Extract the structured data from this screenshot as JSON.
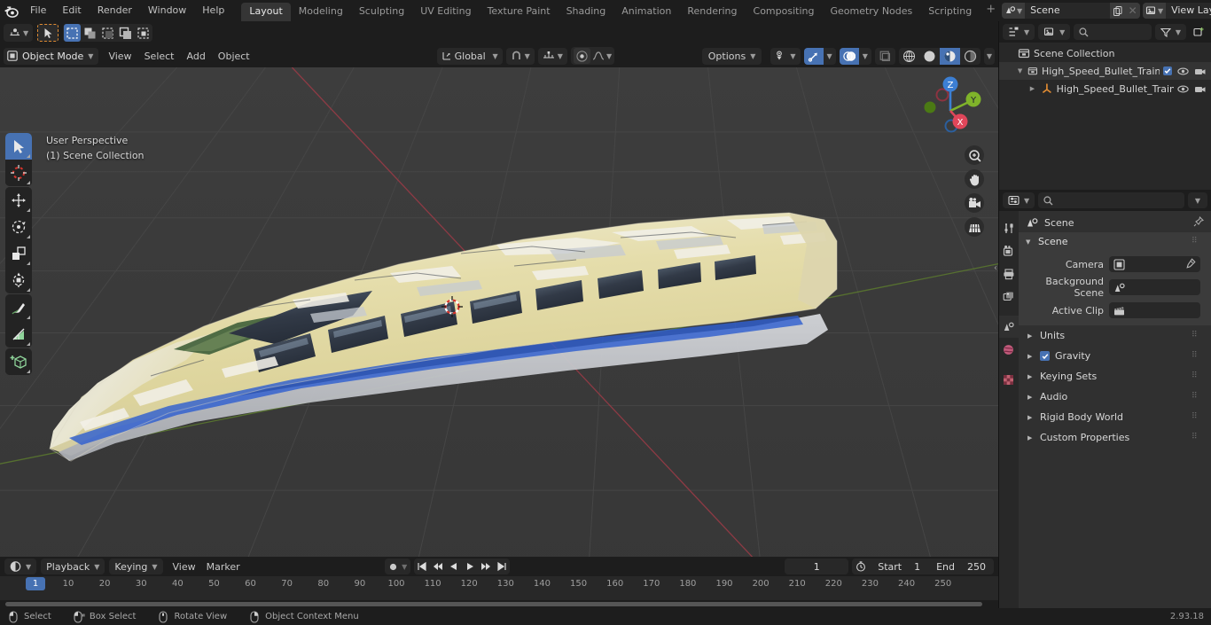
{
  "app": {
    "version": "2.93.18",
    "logo_icon": "blender-logo"
  },
  "topbar": {
    "menus": [
      "File",
      "Edit",
      "Render",
      "Window",
      "Help"
    ],
    "workspaces": [
      {
        "label": "Layout",
        "active": true
      },
      {
        "label": "Modeling",
        "active": false
      },
      {
        "label": "Sculpting",
        "active": false
      },
      {
        "label": "UV Editing",
        "active": false
      },
      {
        "label": "Texture Paint",
        "active": false
      },
      {
        "label": "Shading",
        "active": false
      },
      {
        "label": "Animation",
        "active": false
      },
      {
        "label": "Rendering",
        "active": false
      },
      {
        "label": "Compositing",
        "active": false
      },
      {
        "label": "Geometry Nodes",
        "active": false
      },
      {
        "label": "Scripting",
        "active": false
      }
    ],
    "add_workspace_label": "+",
    "scene": {
      "name": "Scene",
      "icon": "scene-icon",
      "copy_icon": "duplicate-icon",
      "close_icon": "x-icon"
    },
    "view_layer": {
      "name": "View Layer",
      "icon": "view-layer-icon",
      "copy_icon": "duplicate-icon",
      "close_icon": "x-icon"
    }
  },
  "toolheader": {
    "editor_type_icon": "editor-type-icon",
    "active_tool_icon": "tweak-cursor-icon",
    "select_modes": [
      {
        "icon": "select-new-icon",
        "active": true
      },
      {
        "icon": "select-extend-icon",
        "active": false
      },
      {
        "icon": "select-subtract-icon",
        "active": false
      },
      {
        "icon": "select-invert-icon",
        "active": false
      },
      {
        "icon": "select-intersect-icon",
        "active": false
      }
    ]
  },
  "viewport_header": {
    "mode": "Object Mode",
    "mode_icon": "object-mode-icon",
    "menus": [
      "View",
      "Select",
      "Add",
      "Object"
    ],
    "transform_orientation": "Global",
    "transform_icon": "orientation-icon",
    "snap_icon": "magnet-icon",
    "snap_target_icon": "snap-increment-icon",
    "proportional_icon": "proportional-edit-icon",
    "falloff_icon": "smooth-falloff-icon",
    "options_label": "Options",
    "visibility_icon": "object-visibility-icon",
    "gizmo_icon": "gizmo-icon",
    "gizmo_active": true,
    "overlay_icon": "overlays-icon",
    "overlay_active": true,
    "xray_icon": "xray-icon",
    "shading_modes": [
      {
        "icon": "wireframe-icon",
        "active": false
      },
      {
        "icon": "solid-icon",
        "active": false
      },
      {
        "icon": "material-preview-icon",
        "active": true
      },
      {
        "icon": "rendered-icon",
        "active": false
      }
    ],
    "shading_dropdown_icon": "chevron-down-icon"
  },
  "viewport": {
    "perspective_label": "User Perspective",
    "collection_label": "(1) Scene Collection",
    "gizmo_axes": [
      {
        "label": "Z",
        "color": "#3c7fd4"
      },
      {
        "label": "Y",
        "color": "#7fb32a"
      },
      {
        "label": "X",
        "color": "#e0465a"
      }
    ],
    "nav_buttons": [
      {
        "icon": "zoom-icon"
      },
      {
        "icon": "pan-hand-icon"
      },
      {
        "icon": "camera-view-icon"
      },
      {
        "icon": "toggle-ortho-grid-icon"
      }
    ],
    "collapse_icon": "chevron-left-icon",
    "tools": [
      {
        "name": "tweak-tool",
        "icon": "cursor-arrow-icon",
        "active": true
      },
      {
        "name": "cursor-tool",
        "icon": "3d-cursor-icon",
        "active": false
      },
      {
        "name": "move-tool",
        "icon": "move-arrows-icon",
        "active": false
      },
      {
        "name": "rotate-tool",
        "icon": "rotate-icon",
        "active": false
      },
      {
        "name": "scale-tool",
        "icon": "scale-icon",
        "active": false
      },
      {
        "name": "transform-tool",
        "icon": "transform-icon",
        "active": false
      },
      {
        "name": "annotate-tool",
        "icon": "pencil-icon",
        "active": false
      },
      {
        "name": "measure-tool",
        "icon": "ruler-icon",
        "active": false
      },
      {
        "name": "add-cube-tool",
        "icon": "add-cube-icon",
        "active": false
      }
    ],
    "model_name": "High_Speed_Bullet_Train",
    "model_colors": {
      "body": "#e3dca8",
      "body_light": "#eeeadc",
      "accent_blue": "#2f5fd0",
      "window_dark": "#2c3340",
      "lower_grey": "#c8cad0",
      "green_tint": "#3f5f3a"
    },
    "background": "#393939",
    "grid_color": "#4a4a4a",
    "axis_x_color": "#9c3b46",
    "axis_y_color": "#5c7a2e"
  },
  "outliner": {
    "display_mode_icon": "outliner-display-icon",
    "filter_icon": "filter-icon",
    "new_collection_icon": "new-collection-icon",
    "search_icon": "search-icon",
    "search_placeholder": "",
    "search_value": "",
    "rows": [
      {
        "label": "Scene Collection",
        "icon": "collection-icon",
        "indent": 0,
        "triangle": "",
        "selected": false,
        "checkbox": false,
        "eye": false,
        "camera": false
      },
      {
        "label": "High_Speed_Bullet_Train_Loc",
        "icon": "collection-icon",
        "indent": 1,
        "triangle": "▼",
        "selected": true,
        "checkbox": true,
        "eye": true,
        "camera": true
      },
      {
        "label": "High_Speed_Bullet_Train",
        "icon": "mesh-object-icon",
        "indent": 2,
        "triangle": "▶",
        "selected": false,
        "checkbox": false,
        "eye": true,
        "camera": true
      }
    ]
  },
  "properties": {
    "editor_icon": "properties-editor-icon",
    "search_icon": "search-icon",
    "search_value": "",
    "options_chevron": "chevron-down-icon",
    "tabs": [
      {
        "name": "tool",
        "icon": "tool-icon",
        "active": false
      },
      {
        "name": "render",
        "icon": "render-camera-icon",
        "active": false
      },
      {
        "name": "output",
        "icon": "printer-icon",
        "active": false
      },
      {
        "name": "view-layer",
        "icon": "images-icon",
        "active": false
      },
      {
        "name": "scene",
        "icon": "scene-cone-icon",
        "active": true
      },
      {
        "name": "world",
        "icon": "world-globe-icon",
        "active": false
      },
      {
        "name": "texture",
        "icon": "checker-texture-icon",
        "active": false
      }
    ],
    "breadcrumb": {
      "label": "Scene",
      "icon": "scene-cone-icon",
      "pin_icon": "pin-icon"
    },
    "scene_panel": {
      "title": "Scene",
      "expanded": true,
      "rows": [
        {
          "label": "Camera",
          "value": "",
          "field_icon": "camera-data-icon",
          "eyedropper": true
        },
        {
          "label": "Background Scene",
          "value": "",
          "field_icon": "scene-cone-icon",
          "eyedropper": false
        },
        {
          "label": "Active Clip",
          "value": "",
          "field_icon": "clapperboard-icon",
          "eyedropper": false
        }
      ]
    },
    "panels": [
      {
        "label": "Units",
        "expanded": false,
        "checkbox": false
      },
      {
        "label": "Gravity",
        "expanded": false,
        "checkbox": true
      },
      {
        "label": "Keying Sets",
        "expanded": false,
        "checkbox": false
      },
      {
        "label": "Audio",
        "expanded": false,
        "checkbox": false
      },
      {
        "label": "Rigid Body World",
        "expanded": false,
        "checkbox": false
      },
      {
        "label": "Custom Properties",
        "expanded": false,
        "checkbox": false
      }
    ]
  },
  "timeline": {
    "editor_icon": "timeline-editor-icon",
    "menus_drop": [
      "Playback",
      "Keying"
    ],
    "menus": [
      "View",
      "Marker"
    ],
    "record_icon": "record-icon",
    "record_chevron": "chevron-down-icon",
    "transport": [
      {
        "name": "jump-start-button",
        "icon": "jump-to-start-icon"
      },
      {
        "name": "prev-keyframe-button",
        "icon": "prev-keyframe-icon"
      },
      {
        "name": "play-reverse-button",
        "icon": "play-reverse-icon"
      },
      {
        "name": "play-button",
        "icon": "play-icon"
      },
      {
        "name": "next-keyframe-button",
        "icon": "next-keyframe-icon"
      },
      {
        "name": "jump-end-button",
        "icon": "jump-to-end-icon"
      }
    ],
    "current_frame": "1",
    "auto_key_icon": "stopwatch-icon",
    "start_label": "Start",
    "start_value": "1",
    "end_label": "End",
    "end_value": "250",
    "playhead_frame": "1",
    "ticks": [
      10,
      20,
      30,
      40,
      50,
      60,
      70,
      80,
      90,
      100,
      110,
      120,
      130,
      140,
      150,
      160,
      170,
      180,
      190,
      200,
      210,
      220,
      230,
      240,
      250
    ]
  },
  "statusbar": {
    "hints": [
      {
        "icon": "mouse-left-icon",
        "label": "Select"
      },
      {
        "icon": "mouse-left-drag-icon",
        "label": "Box Select"
      },
      {
        "icon": "mouse-middle-icon",
        "label": "Rotate View"
      },
      {
        "icon": "mouse-right-icon",
        "label": "Object Context Menu"
      }
    ]
  }
}
